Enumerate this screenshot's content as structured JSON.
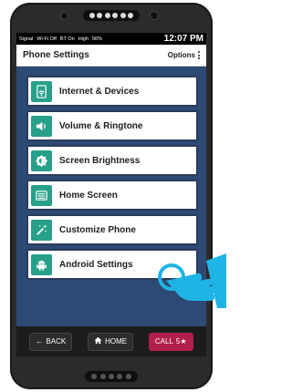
{
  "status_bar": {
    "signal": "Signal",
    "wifi": "Wi-Fi Off",
    "bluetooth": "BT On",
    "volume": "High",
    "battery": "56%",
    "time": "12:07 PM"
  },
  "header": {
    "title": "Phone Settings",
    "options_label": "Options"
  },
  "menu": {
    "items": [
      {
        "label": "Internet & Devices",
        "icon": "wifi-icon"
      },
      {
        "label": "Volume & Ringtone",
        "icon": "speaker-icon"
      },
      {
        "label": "Screen Brightness",
        "icon": "brightness-icon"
      },
      {
        "label": "Home Screen",
        "icon": "home-screen-icon"
      },
      {
        "label": "Customize Phone",
        "icon": "magic-wand-icon"
      },
      {
        "label": "Android Settings",
        "icon": "android-icon"
      }
    ]
  },
  "bottom_bar": {
    "back_label": "BACK",
    "home_label": "HOME",
    "call_label": "CALL",
    "call_badge": "5★"
  },
  "colors": {
    "accent_teal": "#27a08a",
    "screen_background": "#2c4a73",
    "call_button": "#b01f4b",
    "touch_hand": "#1fb4e6"
  }
}
